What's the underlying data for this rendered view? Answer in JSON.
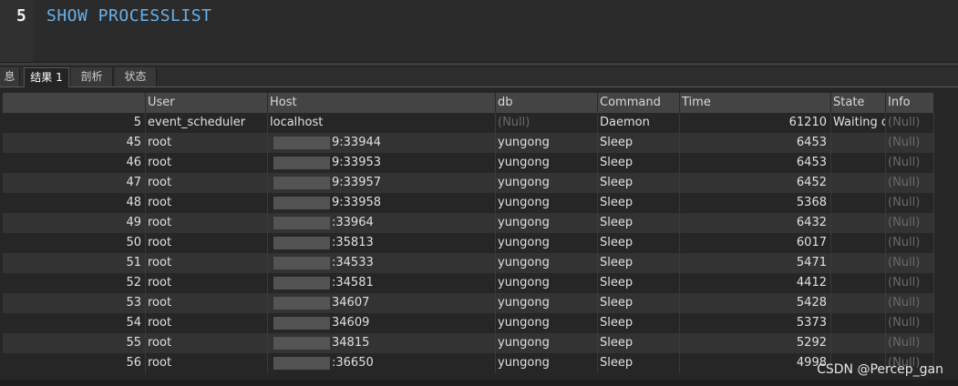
{
  "editor": {
    "line_number": "5",
    "sql": "SHOW PROCESSLIST"
  },
  "tabs": [
    "息",
    "结果 1",
    "剖析",
    "状态"
  ],
  "columns": [
    "",
    "User",
    "Host",
    "db",
    "Command",
    "Time",
    "State",
    "Info"
  ],
  "rows": [
    {
      "id": "5",
      "user": "event_scheduler",
      "host": "localhost",
      "db": "(Null)",
      "command": "Daemon",
      "time": "61210",
      "state": "Waiting o",
      "info": "(Null)"
    },
    {
      "id": "45",
      "user": "root",
      "host": "9:33944",
      "db": "yungong",
      "command": "Sleep",
      "time": "6453",
      "state": "",
      "info": "(Null)"
    },
    {
      "id": "46",
      "user": "root",
      "host": "9:33953",
      "db": "yungong",
      "command": "Sleep",
      "time": "6453",
      "state": "",
      "info": "(Null)"
    },
    {
      "id": "47",
      "user": "root",
      "host": "9:33957",
      "db": "yungong",
      "command": "Sleep",
      "time": "6452",
      "state": "",
      "info": "(Null)"
    },
    {
      "id": "48",
      "user": "root",
      "host": "9:33958",
      "db": "yungong",
      "command": "Sleep",
      "time": "5368",
      "state": "",
      "info": "(Null)"
    },
    {
      "id": "49",
      "user": "root",
      "host": ":33964",
      "db": "yungong",
      "command": "Sleep",
      "time": "6432",
      "state": "",
      "info": "(Null)"
    },
    {
      "id": "50",
      "user": "root",
      "host": ":35813",
      "db": "yungong",
      "command": "Sleep",
      "time": "6017",
      "state": "",
      "info": "(Null)"
    },
    {
      "id": "51",
      "user": "root",
      "host": ":34533",
      "db": "yungong",
      "command": "Sleep",
      "time": "5471",
      "state": "",
      "info": "(Null)"
    },
    {
      "id": "52",
      "user": "root",
      "host": ":34581",
      "db": "yungong",
      "command": "Sleep",
      "time": "4412",
      "state": "",
      "info": "(Null)"
    },
    {
      "id": "53",
      "user": "root",
      "host": "34607",
      "db": "yungong",
      "command": "Sleep",
      "time": "5428",
      "state": "",
      "info": "(Null)"
    },
    {
      "id": "54",
      "user": "root",
      "host": "34609",
      "db": "yungong",
      "command": "Sleep",
      "time": "5373",
      "state": "",
      "info": "(Null)"
    },
    {
      "id": "55",
      "user": "root",
      "host": "34815",
      "db": "yungong",
      "command": "Sleep",
      "time": "5292",
      "state": "",
      "info": "(Null)"
    },
    {
      "id": "56",
      "user": "root",
      "host": ":36650",
      "db": "yungong",
      "command": "Sleep",
      "time": "4998",
      "state": "",
      "info": "(Null)"
    }
  ],
  "watermark": "CSDN @Percep_gan",
  "colors": {
    "sql_keyword": "#69b0e8",
    "null_text": "#6a6a6a",
    "row_alt": "#333333",
    "header_bg": "#444444"
  }
}
